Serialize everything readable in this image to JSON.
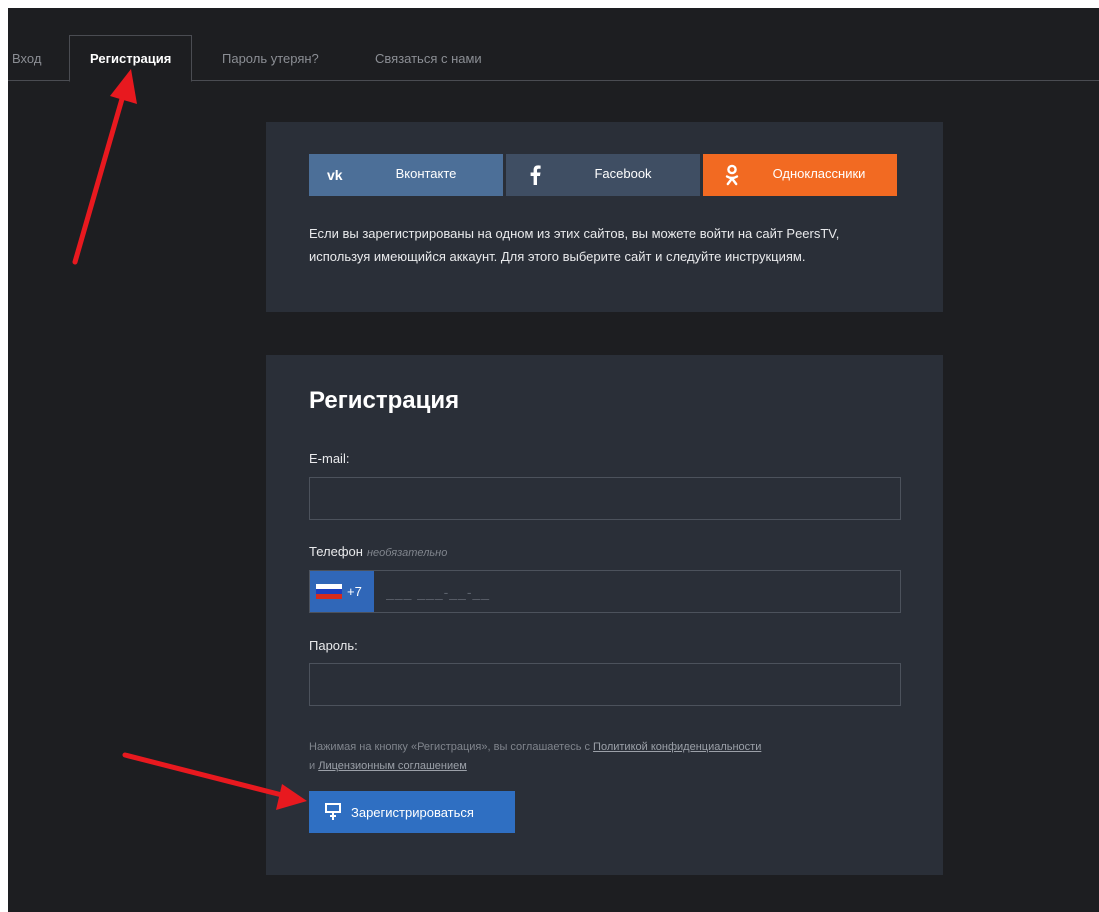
{
  "tabs": [
    {
      "label": "Вход"
    },
    {
      "label": "Регистрация"
    },
    {
      "label": "Пароль утерян?"
    },
    {
      "label": "Связаться с нами"
    }
  ],
  "social": {
    "vk": {
      "label": "Вконтакте",
      "color": "#4c6f98"
    },
    "facebook": {
      "label": "Facebook",
      "color": "#3f4e63"
    },
    "ok": {
      "label": "Одноклассники",
      "color": "#f26a22"
    },
    "note": "Если вы зарегистрированы на одном из этих сайтов, вы можете войти на сайт PeersTV, используя имеющийся аккаунт. Для этого выберите сайт и следуйте инструкциям."
  },
  "register": {
    "title": "Регистрация",
    "email_label": "E-mail:",
    "email_value": "",
    "phone_label": "Телефон",
    "phone_optional": "необязательно",
    "phone_prefix": "+7",
    "phone_placeholder": "___ ___-__-__",
    "password_label": "Пароль:",
    "password_value": "",
    "terms_text": "Нажимая на кнопку «Регистрация», вы соглашаетесь с",
    "privacy_link": "Политикой конфиденциальности",
    "terms_and": "и",
    "license_link": "Лицензионным соглашением",
    "submit_label": "Зарегистрироваться"
  },
  "colors": {
    "background": "#1d1e21",
    "card": "#2a2f38",
    "accent": "#2f6fc2",
    "annotation_arrow": "#e8191f"
  }
}
